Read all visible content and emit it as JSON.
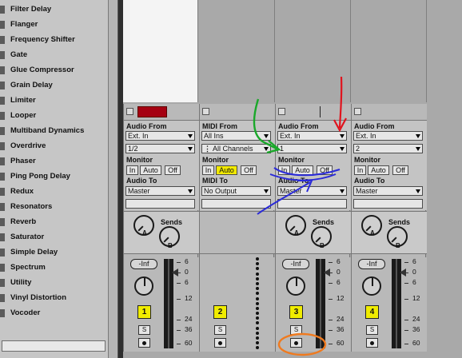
{
  "browser": {
    "items": [
      "Filter Delay",
      "Flanger",
      "Frequency Shifter",
      "Gate",
      "Glue Compressor",
      "Grain Delay",
      "Limiter",
      "Looper",
      "Multiband Dynamics",
      "Overdrive",
      "Phaser",
      "Ping Pong Delay",
      "Redux",
      "Resonators",
      "Reverb",
      "Saturator",
      "Simple Delay",
      "Spectrum",
      "Utility",
      "Vinyl Distortion",
      "Vocoder"
    ]
  },
  "tracks": [
    {
      "type": "audio",
      "from_label": "Audio From",
      "from_value": "Ext. In",
      "channel_value": "1/2",
      "monitor_label": "Monitor",
      "monitor": [
        "In",
        "Auto",
        "Off"
      ],
      "monitor_active": "",
      "to_label": "Audio To",
      "to_value": "Master",
      "sends_label": "Sends",
      "send_a": "A",
      "send_b": "B",
      "volume": "-Inf",
      "number": "1",
      "solo": "S",
      "armed_color": "#a50011"
    },
    {
      "type": "midi",
      "from_label": "MIDI From",
      "from_value": "All Ins",
      "channel_value": "All Channels",
      "monitor_label": "Monitor",
      "monitor": [
        "In",
        "Auto",
        "Off"
      ],
      "monitor_active": "Auto",
      "to_label": "MIDI To",
      "to_value": "No Output",
      "number": "2",
      "solo": "S"
    },
    {
      "type": "audio",
      "from_label": "Audio From",
      "from_value": "Ext. In",
      "channel_value": "1",
      "monitor_label": "Monitor",
      "monitor": [
        "In",
        "Auto",
        "Off"
      ],
      "monitor_active": "",
      "to_label": "Audio To",
      "to_value": "Master",
      "sends_label": "Sends",
      "send_a": "A",
      "send_b": "B",
      "volume": "-Inf",
      "number": "3",
      "solo": "S"
    },
    {
      "type": "audio",
      "from_label": "Audio From",
      "from_value": "Ext. In",
      "channel_value": "2",
      "monitor_label": "Monitor",
      "monitor": [
        "In",
        "Auto",
        "Off"
      ],
      "monitor_active": "",
      "to_label": "Audio To",
      "to_value": "Master",
      "sends_label": "Sends",
      "send_a": "A",
      "send_b": "B",
      "volume": "-Inf",
      "number": "4",
      "solo": "S"
    }
  ],
  "meter_scale": [
    "6",
    "0",
    "6",
    "12",
    "24",
    "36",
    "60"
  ],
  "colors": {
    "track_number_bg": "#f0ec00",
    "monitor_active_bg": "#f2ea00",
    "annotation_red": "#e0141e",
    "annotation_green": "#1aa82a",
    "annotation_blue": "#2a2ad8",
    "annotation_orange": "#f07a1e"
  }
}
